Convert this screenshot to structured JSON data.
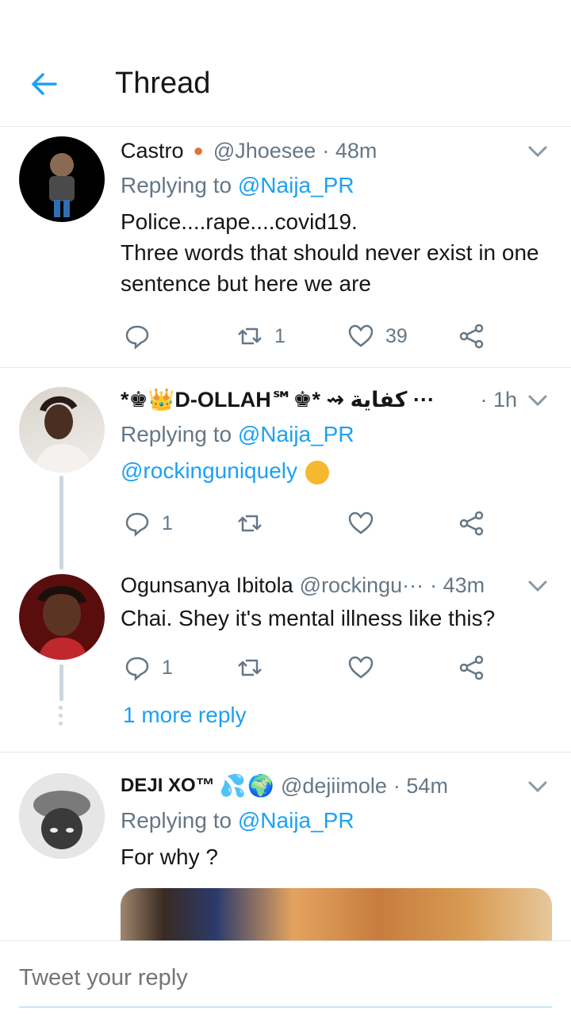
{
  "header": {
    "title": "Thread"
  },
  "colors": {
    "accent": "#1da1f2",
    "muted": "#657786",
    "divider": "#e1e8ed"
  },
  "tweets": [
    {
      "name": "Castro",
      "handle": "@Jhoesee",
      "time": "· 48m",
      "replying_prefix": "Replying to ",
      "replying_to": "@Naija_PR",
      "text": "Police....rape....covid19.\nThree words that should never exist in one sentence but here we are",
      "reply_count": "",
      "retweet_count": "1",
      "like_count": "39"
    },
    {
      "name": "*♚👑D-OLLAH℠♚* ⇝ كفاية ···",
      "handle": "",
      "time": "· 1h",
      "replying_prefix": "Replying to ",
      "replying_to": "@Naija_PR",
      "mention": "@rockinguniquely",
      "reply_count": "1",
      "retweet_count": "",
      "like_count": ""
    },
    {
      "name": "Ogunsanya Ibitola",
      "handle": "@rockingu···",
      "time": "· 43m",
      "text": "Chai. Shey it's mental illness like this?",
      "reply_count": "1",
      "retweet_count": "",
      "like_count": ""
    },
    {
      "name": "DEJI XO™",
      "handle": "@dejiimole",
      "time": "· 54m",
      "replying_prefix": "Replying to ",
      "replying_to": "@Naija_PR",
      "text": "For why ?"
    }
  ],
  "more_reply": "1 more reply",
  "composer": {
    "placeholder": "Tweet your reply"
  }
}
